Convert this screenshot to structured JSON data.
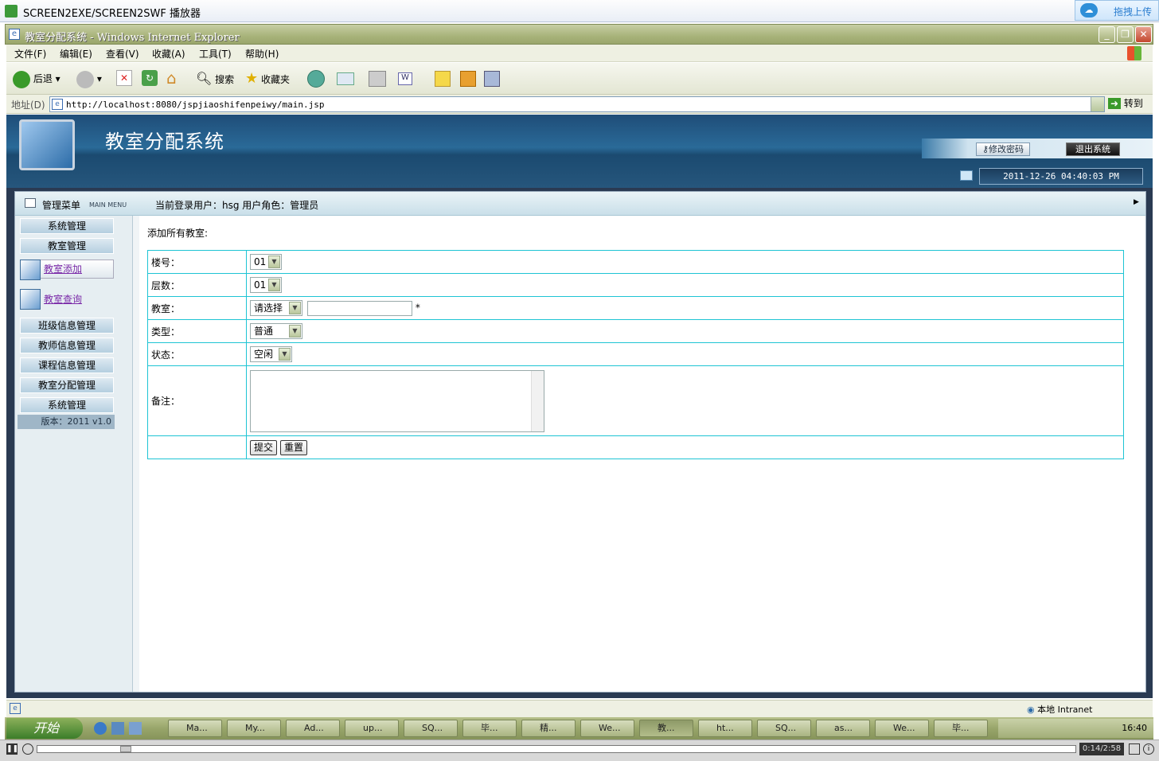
{
  "player": {
    "title": "SCREEN2EXE/SCREEN2SWF 播放器",
    "upload": "拖拽上传",
    "time": "0:14/2:58"
  },
  "browser": {
    "title": "教室分配系统 - Windows Internet Explorer",
    "menu": [
      "文件(F)",
      "编辑(E)",
      "查看(V)",
      "收藏(A)",
      "工具(T)",
      "帮助(H)"
    ],
    "back": "后退",
    "search": "搜索",
    "favorites": "收藏夹",
    "address_label": "地址(D)",
    "url": "http://localhost:8080/jspjiaoshifenpeiwy/main.jsp",
    "go": "转到",
    "status_zone": "本地 Intranet"
  },
  "app": {
    "title": "教室分配系统",
    "change_pwd": "修改密码",
    "logout": "退出系统",
    "datetime": "2011-12-26 04:40:03 PM",
    "menu_title": "管理菜单",
    "menu_sub": "MAIN MENU",
    "login_info": "当前登录用户：hsg  用户角色：管理员",
    "sidebar": {
      "sys": "系统管理",
      "room": "教室管理",
      "add": "教室添加",
      "query": "教室查询",
      "class": "班级信息管理",
      "teacher": "教师信息管理",
      "course": "课程信息管理",
      "assign": "教室分配管理",
      "sys2": "系统管理",
      "version": "版本：2011 v1.0"
    },
    "form": {
      "title": "添加所有教室:",
      "labels": {
        "building": "楼号：",
        "floor": "层数：",
        "room": "教室：",
        "type": "类型：",
        "status": "状态：",
        "note": "备注："
      },
      "values": {
        "building": "01",
        "floor": "01",
        "room": "请选择",
        "type": "普通",
        "status": "空闲",
        "required": "*"
      },
      "submit": "提交",
      "reset": "重置"
    }
  },
  "taskbar": {
    "start": "开始",
    "items": [
      "Ma...",
      "My...",
      "Ad...",
      "up...",
      "SQ...",
      "毕...",
      "精...",
      "We...",
      "教...",
      "ht...",
      "SQ...",
      "as...",
      "We...",
      "毕..."
    ],
    "clock": "16:40"
  }
}
